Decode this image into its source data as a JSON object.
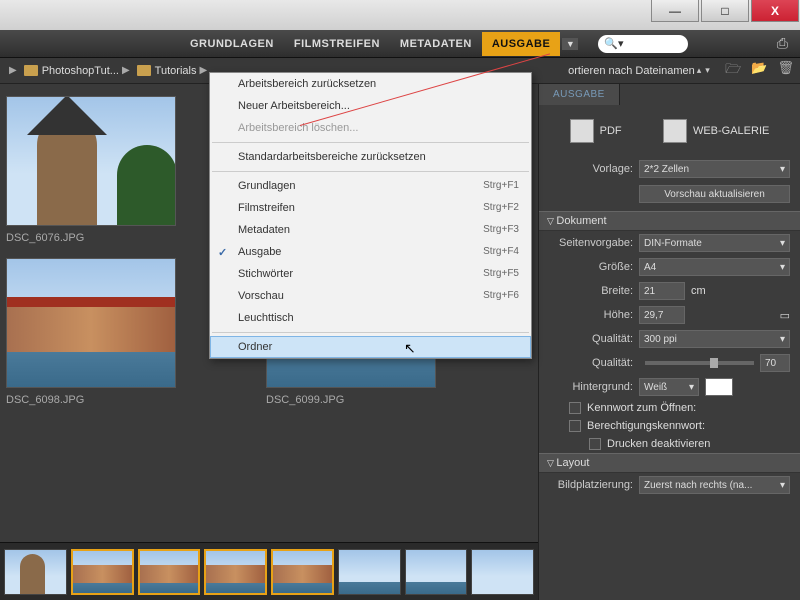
{
  "window": {
    "min": "—",
    "max": "□",
    "close": "X"
  },
  "tabs": {
    "grundlagen": "GRUNDLAGEN",
    "filmstreifen": "FILMSTREIFEN",
    "metadaten": "METADATEN",
    "ausgabe": "AUSGABE"
  },
  "search": {
    "icon": "🔍▾"
  },
  "breadcrumb": {
    "item0": "PhotoshopTut...",
    "item1": "Tutorials"
  },
  "sort": {
    "label": "ortieren nach Dateinamen"
  },
  "dropdown": {
    "reset_workspace": "Arbeitsbereich zurücksetzen",
    "new_workspace": "Neuer Arbeitsbereich...",
    "delete_workspace": "Arbeitsbereich löschen...",
    "reset_default": "Standardarbeitsbereiche zurücksetzen",
    "grundlagen": "Grundlagen",
    "sc_grundlagen": "Strg+F1",
    "filmstreifen": "Filmstreifen",
    "sc_filmstreifen": "Strg+F2",
    "metadaten": "Metadaten",
    "sc_metadaten": "Strg+F3",
    "ausgabe": "Ausgabe",
    "sc_ausgabe": "Strg+F4",
    "stichwoerter": "Stichwörter",
    "sc_stichwoerter": "Strg+F5",
    "vorschau": "Vorschau",
    "sc_vorschau": "Strg+F6",
    "leuchttisch": "Leuchttisch",
    "ordner": "Ordner"
  },
  "thumbs": {
    "t0": "DSC_6076.JPG",
    "t1": "DSC_6098.JPG",
    "t2": "DSC_6099.JPG"
  },
  "panel": {
    "tab": "AUSGABE",
    "pdf": "PDF",
    "webgal": "WEB-GALERIE",
    "vorlage": "Vorlage:",
    "vorlage_val": "2*2 Zellen",
    "refresh": "Vorschau aktualisieren",
    "sec_dokument": "Dokument",
    "seitenvorgabe": "Seitenvorgabe:",
    "seitenvorgabe_val": "DIN-Formate",
    "groesse": "Größe:",
    "groesse_val": "A4",
    "breite": "Breite:",
    "breite_val": "21",
    "unit": "cm",
    "hoehe": "Höhe:",
    "hoehe_val": "29,7",
    "qualitaet": "Qualität:",
    "qualitaet_val": "300 ppi",
    "qualitaet2": "Qualität:",
    "qualitaet2_val": "70",
    "hintergrund": "Hintergrund:",
    "hintergrund_val": "Weiß",
    "kennwort": "Kennwort zum Öffnen:",
    "berechtigungs": "Berechtigungskennwort:",
    "drucken": "Drucken deaktivieren",
    "sec_layout": "Layout",
    "bildplatzierung": "Bildplatzierung:",
    "bildplatzierung_val": "Zuerst nach rechts (na..."
  }
}
